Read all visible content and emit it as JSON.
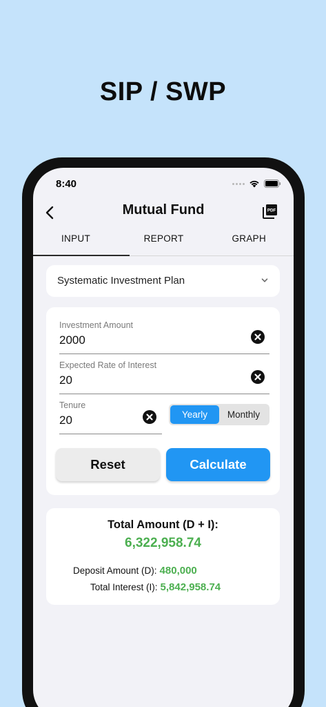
{
  "headline": "SIP / SWP",
  "status": {
    "time": "8:40"
  },
  "app_bar": {
    "title": "Mutual Fund"
  },
  "tabs": [
    {
      "label": "INPUT",
      "active": true
    },
    {
      "label": "REPORT",
      "active": false
    },
    {
      "label": "GRAPH",
      "active": false
    }
  ],
  "plan": {
    "selected": "Systematic Investment Plan"
  },
  "fields": {
    "investment": {
      "label": "Investment Amount",
      "value": "2000"
    },
    "rate": {
      "label": "Expected Rate of Interest",
      "value": "20"
    },
    "tenure": {
      "label": "Tenure",
      "value": "20"
    }
  },
  "tenure_toggle": {
    "yearly": "Yearly",
    "monthly": "Monthly",
    "selected": "Yearly"
  },
  "buttons": {
    "reset": "Reset",
    "calculate": "Calculate"
  },
  "result": {
    "total_label": "Total Amount (D + I):",
    "total_value": "6,322,958.74",
    "deposit_label": "Deposit Amount (D):",
    "deposit_value": "480,000",
    "interest_label": "Total Interest (I):",
    "interest_value": "5,842,958.74"
  },
  "colors": {
    "accent": "#2196f3",
    "positive": "#4caf50",
    "background": "#c5e3fb"
  },
  "icons": [
    "back-arrow-icon",
    "pdf-icon",
    "chevron-down-icon",
    "clear-icon",
    "wifi-icon",
    "battery-icon",
    "signal-dots-icon"
  ]
}
